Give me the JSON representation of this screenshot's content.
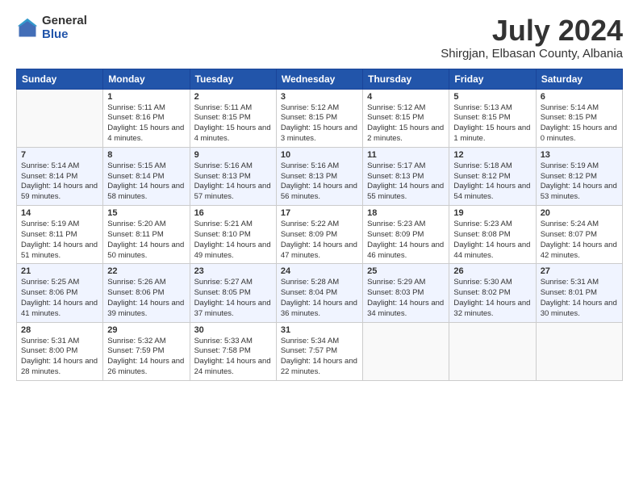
{
  "logo": {
    "general": "General",
    "blue": "Blue"
  },
  "title": "July 2024",
  "subtitle": "Shirgjan, Elbasan County, Albania",
  "days_of_week": [
    "Sunday",
    "Monday",
    "Tuesday",
    "Wednesday",
    "Thursday",
    "Friday",
    "Saturday"
  ],
  "weeks": [
    [
      {
        "day": "",
        "sunrise": "",
        "sunset": "",
        "daylight": ""
      },
      {
        "day": "1",
        "sunrise": "Sunrise: 5:11 AM",
        "sunset": "Sunset: 8:16 PM",
        "daylight": "Daylight: 15 hours and 4 minutes."
      },
      {
        "day": "2",
        "sunrise": "Sunrise: 5:11 AM",
        "sunset": "Sunset: 8:15 PM",
        "daylight": "Daylight: 15 hours and 4 minutes."
      },
      {
        "day": "3",
        "sunrise": "Sunrise: 5:12 AM",
        "sunset": "Sunset: 8:15 PM",
        "daylight": "Daylight: 15 hours and 3 minutes."
      },
      {
        "day": "4",
        "sunrise": "Sunrise: 5:12 AM",
        "sunset": "Sunset: 8:15 PM",
        "daylight": "Daylight: 15 hours and 2 minutes."
      },
      {
        "day": "5",
        "sunrise": "Sunrise: 5:13 AM",
        "sunset": "Sunset: 8:15 PM",
        "daylight": "Daylight: 15 hours and 1 minute."
      },
      {
        "day": "6",
        "sunrise": "Sunrise: 5:14 AM",
        "sunset": "Sunset: 8:15 PM",
        "daylight": "Daylight: 15 hours and 0 minutes."
      }
    ],
    [
      {
        "day": "7",
        "sunrise": "Sunrise: 5:14 AM",
        "sunset": "Sunset: 8:14 PM",
        "daylight": "Daylight: 14 hours and 59 minutes."
      },
      {
        "day": "8",
        "sunrise": "Sunrise: 5:15 AM",
        "sunset": "Sunset: 8:14 PM",
        "daylight": "Daylight: 14 hours and 58 minutes."
      },
      {
        "day": "9",
        "sunrise": "Sunrise: 5:16 AM",
        "sunset": "Sunset: 8:13 PM",
        "daylight": "Daylight: 14 hours and 57 minutes."
      },
      {
        "day": "10",
        "sunrise": "Sunrise: 5:16 AM",
        "sunset": "Sunset: 8:13 PM",
        "daylight": "Daylight: 14 hours and 56 minutes."
      },
      {
        "day": "11",
        "sunrise": "Sunrise: 5:17 AM",
        "sunset": "Sunset: 8:13 PM",
        "daylight": "Daylight: 14 hours and 55 minutes."
      },
      {
        "day": "12",
        "sunrise": "Sunrise: 5:18 AM",
        "sunset": "Sunset: 8:12 PM",
        "daylight": "Daylight: 14 hours and 54 minutes."
      },
      {
        "day": "13",
        "sunrise": "Sunrise: 5:19 AM",
        "sunset": "Sunset: 8:12 PM",
        "daylight": "Daylight: 14 hours and 53 minutes."
      }
    ],
    [
      {
        "day": "14",
        "sunrise": "Sunrise: 5:19 AM",
        "sunset": "Sunset: 8:11 PM",
        "daylight": "Daylight: 14 hours and 51 minutes."
      },
      {
        "day": "15",
        "sunrise": "Sunrise: 5:20 AM",
        "sunset": "Sunset: 8:11 PM",
        "daylight": "Daylight: 14 hours and 50 minutes."
      },
      {
        "day": "16",
        "sunrise": "Sunrise: 5:21 AM",
        "sunset": "Sunset: 8:10 PM",
        "daylight": "Daylight: 14 hours and 49 minutes."
      },
      {
        "day": "17",
        "sunrise": "Sunrise: 5:22 AM",
        "sunset": "Sunset: 8:09 PM",
        "daylight": "Daylight: 14 hours and 47 minutes."
      },
      {
        "day": "18",
        "sunrise": "Sunrise: 5:23 AM",
        "sunset": "Sunset: 8:09 PM",
        "daylight": "Daylight: 14 hours and 46 minutes."
      },
      {
        "day": "19",
        "sunrise": "Sunrise: 5:23 AM",
        "sunset": "Sunset: 8:08 PM",
        "daylight": "Daylight: 14 hours and 44 minutes."
      },
      {
        "day": "20",
        "sunrise": "Sunrise: 5:24 AM",
        "sunset": "Sunset: 8:07 PM",
        "daylight": "Daylight: 14 hours and 42 minutes."
      }
    ],
    [
      {
        "day": "21",
        "sunrise": "Sunrise: 5:25 AM",
        "sunset": "Sunset: 8:06 PM",
        "daylight": "Daylight: 14 hours and 41 minutes."
      },
      {
        "day": "22",
        "sunrise": "Sunrise: 5:26 AM",
        "sunset": "Sunset: 8:06 PM",
        "daylight": "Daylight: 14 hours and 39 minutes."
      },
      {
        "day": "23",
        "sunrise": "Sunrise: 5:27 AM",
        "sunset": "Sunset: 8:05 PM",
        "daylight": "Daylight: 14 hours and 37 minutes."
      },
      {
        "day": "24",
        "sunrise": "Sunrise: 5:28 AM",
        "sunset": "Sunset: 8:04 PM",
        "daylight": "Daylight: 14 hours and 36 minutes."
      },
      {
        "day": "25",
        "sunrise": "Sunrise: 5:29 AM",
        "sunset": "Sunset: 8:03 PM",
        "daylight": "Daylight: 14 hours and 34 minutes."
      },
      {
        "day": "26",
        "sunrise": "Sunrise: 5:30 AM",
        "sunset": "Sunset: 8:02 PM",
        "daylight": "Daylight: 14 hours and 32 minutes."
      },
      {
        "day": "27",
        "sunrise": "Sunrise: 5:31 AM",
        "sunset": "Sunset: 8:01 PM",
        "daylight": "Daylight: 14 hours and 30 minutes."
      }
    ],
    [
      {
        "day": "28",
        "sunrise": "Sunrise: 5:31 AM",
        "sunset": "Sunset: 8:00 PM",
        "daylight": "Daylight: 14 hours and 28 minutes."
      },
      {
        "day": "29",
        "sunrise": "Sunrise: 5:32 AM",
        "sunset": "Sunset: 7:59 PM",
        "daylight": "Daylight: 14 hours and 26 minutes."
      },
      {
        "day": "30",
        "sunrise": "Sunrise: 5:33 AM",
        "sunset": "Sunset: 7:58 PM",
        "daylight": "Daylight: 14 hours and 24 minutes."
      },
      {
        "day": "31",
        "sunrise": "Sunrise: 5:34 AM",
        "sunset": "Sunset: 7:57 PM",
        "daylight": "Daylight: 14 hours and 22 minutes."
      },
      {
        "day": "",
        "sunrise": "",
        "sunset": "",
        "daylight": ""
      },
      {
        "day": "",
        "sunrise": "",
        "sunset": "",
        "daylight": ""
      },
      {
        "day": "",
        "sunrise": "",
        "sunset": "",
        "daylight": ""
      }
    ]
  ]
}
